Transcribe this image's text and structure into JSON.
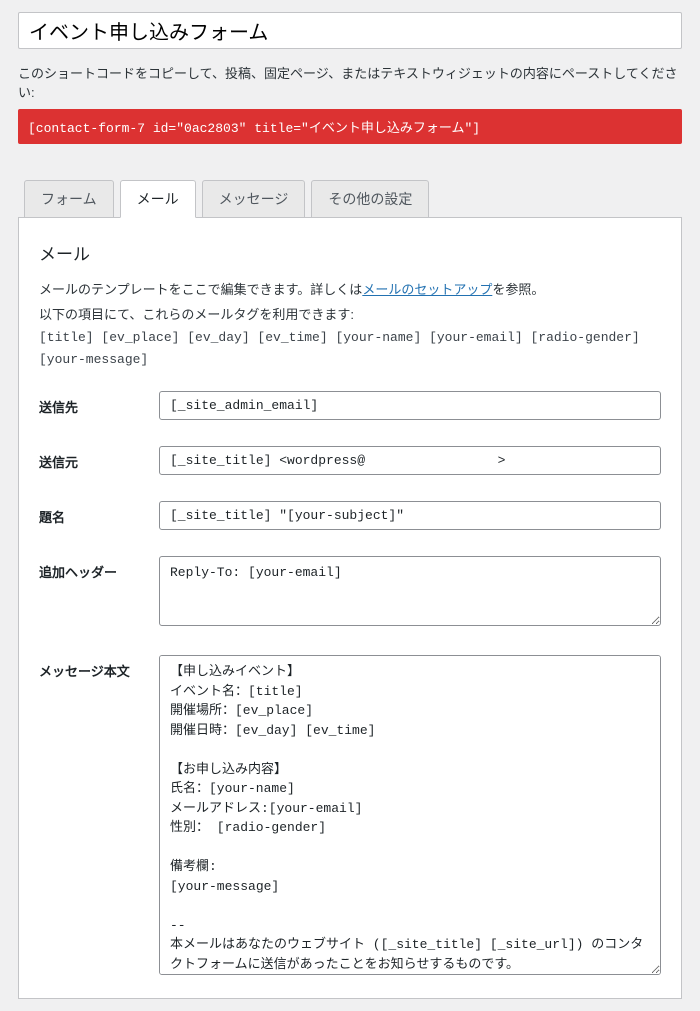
{
  "title": "イベント申し込みフォーム",
  "shortcode_desc": "このショートコードをコピーして、投稿、固定ページ、またはテキストウィジェットの内容にペーストしてください:",
  "shortcode": "[contact-form-7 id=\"0ac2803\" title=\"イベント申し込みフォーム\"]",
  "tabs": {
    "form": "フォーム",
    "mail": "メール",
    "messages": "メッセージ",
    "additional": "その他の設定"
  },
  "mail_panel": {
    "heading": "メール",
    "desc_pre": "メールのテンプレートをここで編集できます。詳しくは",
    "desc_link": "メールのセットアップ",
    "desc_post": "を参照。",
    "tags_label": "以下の項目にて、これらのメールタグを利用できます:",
    "tags": "[title] [ev_place] [ev_day] [ev_time] [your-name] [your-email] [radio-gender] [your-message]",
    "fields": {
      "to_label": "送信先",
      "to_value": "[_site_admin_email]",
      "from_label": "送信元",
      "from_value": "[_site_title] <wordpress@                 >",
      "subject_label": "題名",
      "subject_value": "[_site_title] \"[your-subject]\"",
      "headers_label": "追加ヘッダー",
      "headers_value": "Reply-To: [your-email]",
      "body_label": "メッセージ本文",
      "body_value": "【申し込みイベント】\nイベント名：[title]\n開催場所：[ev_place]\n開催日時：[ev_day] [ev_time]\n\n【お申し込み内容】\n氏名：[your-name]\nメールアドレス:[your-email]\n性別： [radio-gender]\n\n備考欄:\n[your-message]\n\n-- \n本メールはあなたのウェブサイト ([_site_title] [_site_url]) のコンタクトフォームに送信があったことをお知らせするものです。"
    }
  }
}
